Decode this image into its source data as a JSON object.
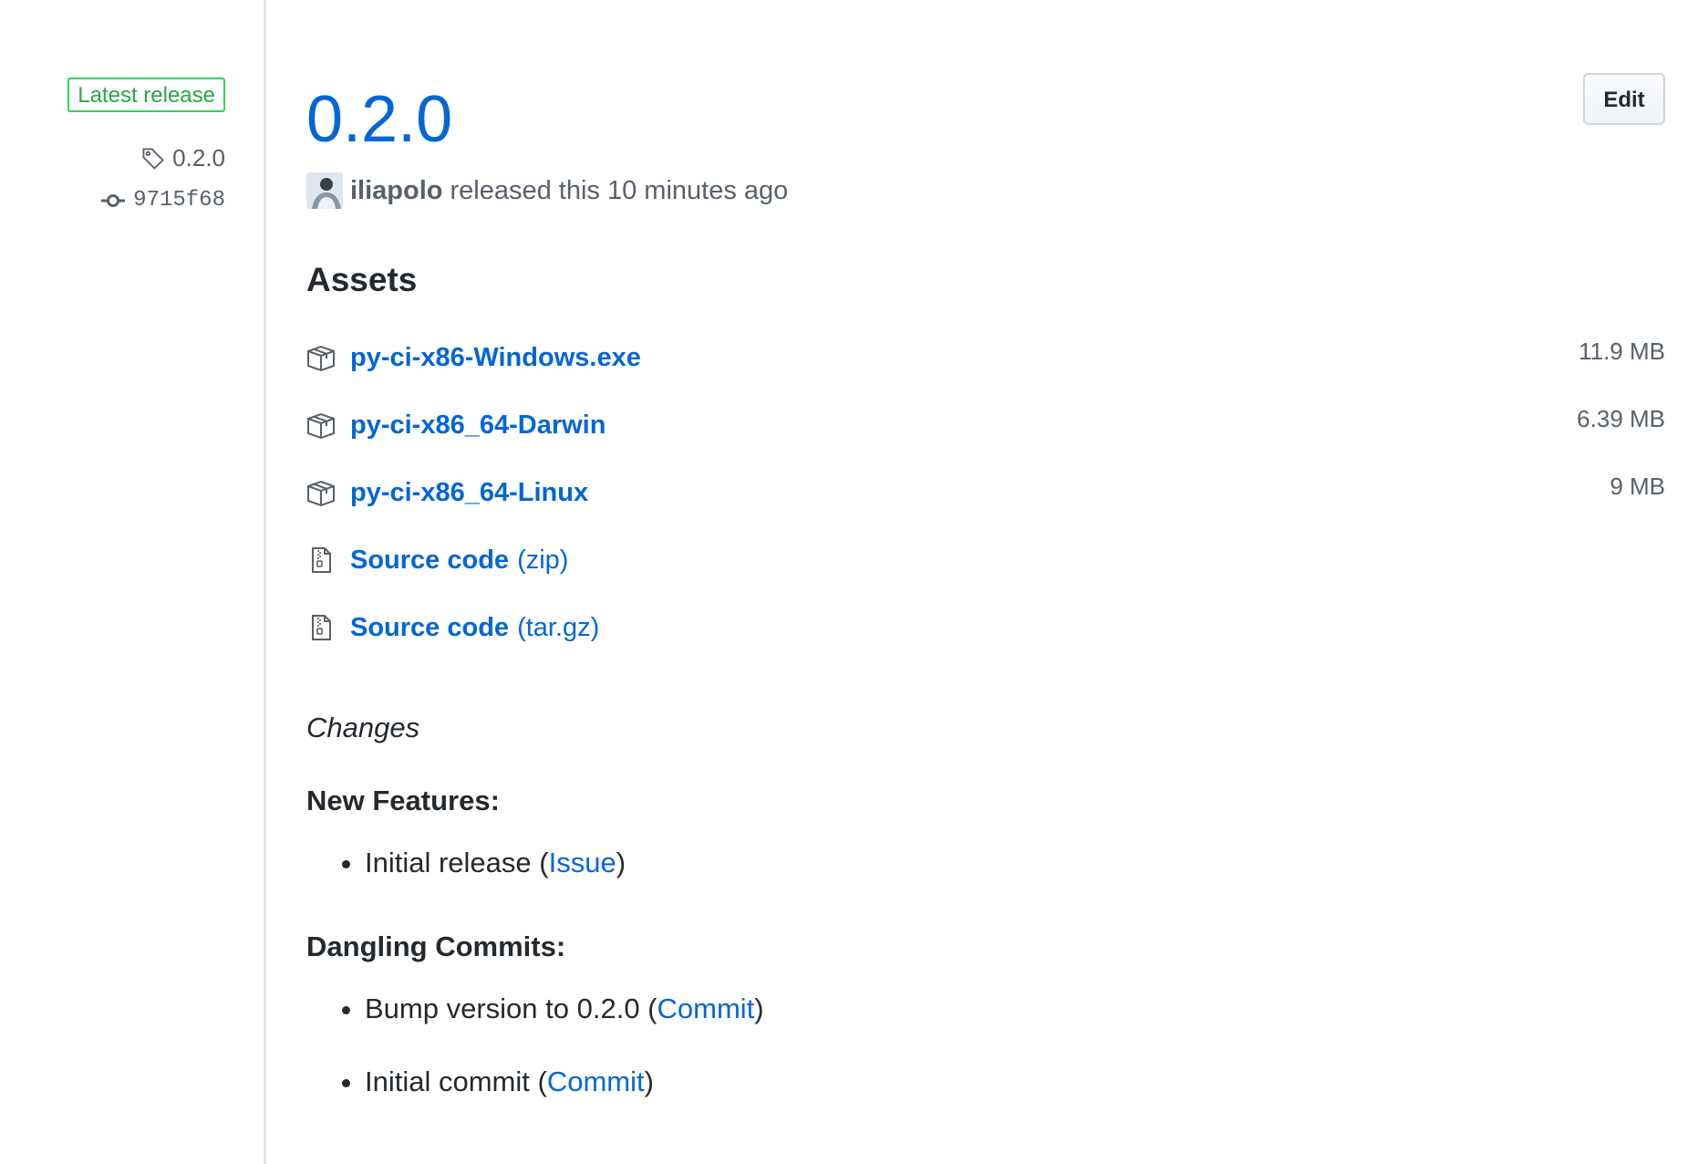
{
  "sidebar": {
    "badge": "Latest release",
    "tag": "0.2.0",
    "commit": "9715f68"
  },
  "release": {
    "title": "0.2.0",
    "edit_label": "Edit",
    "author": "iliapolo",
    "released_text": "released this 10 minutes ago"
  },
  "assets": {
    "heading": "Assets",
    "items": [
      {
        "name": "py-ci-x86-Windows.exe",
        "ext": "",
        "size": "11.9 MB",
        "icon": "package-icon"
      },
      {
        "name": "py-ci-x86_64-Darwin",
        "ext": "",
        "size": "6.39 MB",
        "icon": "package-icon"
      },
      {
        "name": "py-ci-x86_64-Linux",
        "ext": "",
        "size": "9 MB",
        "icon": "package-icon"
      },
      {
        "name": "Source code",
        "ext": "(zip)",
        "size": "",
        "icon": "file-zip-icon"
      },
      {
        "name": "Source code",
        "ext": "(tar.gz)",
        "size": "",
        "icon": "file-zip-icon"
      }
    ]
  },
  "notes": {
    "changes": "Changes",
    "new_features_heading": "New Features:",
    "new_features": [
      {
        "text": "Initial release (",
        "link": "Issue",
        "suffix": ")"
      }
    ],
    "dangling_heading": "Dangling Commits:",
    "dangling": [
      {
        "text": "Bump version to 0.2.0 (",
        "link": "Commit",
        "suffix": ")"
      },
      {
        "text": "Initial commit (",
        "link": "Commit",
        "suffix": ")"
      }
    ]
  },
  "colors": {
    "link": "#0366d6",
    "badge_green": "#28a745",
    "muted": "#586069",
    "text": "#24292e"
  }
}
